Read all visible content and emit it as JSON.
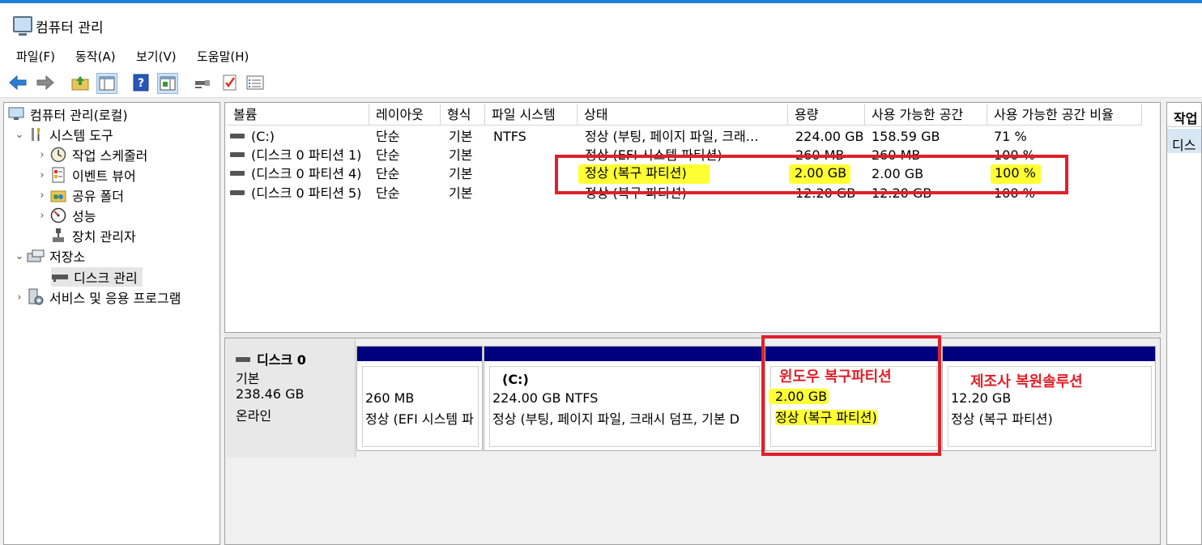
{
  "window": {
    "title": "컴퓨터 관리"
  },
  "menu": [
    "파일(F)",
    "동작(A)",
    "보기(V)",
    "도움말(H)"
  ],
  "toolbar_icons": [
    "back-arrow-icon",
    "forward-arrow-icon",
    "up-folder-icon",
    "show-hide-tree-icon",
    "help-icon",
    "action-pane-icon",
    "connect-icon",
    "check-icon",
    "properties-icon"
  ],
  "tree": {
    "root": "컴퓨터 관리(로컬)",
    "system_tools": "시스템 도구",
    "task_scheduler": "작업 스케줄러",
    "event_viewer": "이벤트 뷰어",
    "shared_folders": "공유 폴더",
    "performance": "성능",
    "device_manager": "장치 관리자",
    "storage": "저장소",
    "disk_management": "디스크 관리",
    "services": "서비스 및 응용 프로그램"
  },
  "columns": [
    "볼륨",
    "레이아웃",
    "형식",
    "파일 시스템",
    "상태",
    "용량",
    "사용 가능한 공간",
    "사용 가능한 공간 비율"
  ],
  "rows": [
    {
      "volume": "(C:)",
      "layout": "단순",
      "type": "기본",
      "fs": "NTFS",
      "status": "정상 (부팅, 페이지 파일, 크래…",
      "capacity": "224.00 GB",
      "free": "158.59 GB",
      "pct": "71 %"
    },
    {
      "volume": "(디스크 0 파티션 1)",
      "layout": "단순",
      "type": "기본",
      "fs": "",
      "status": "정상 (EFI 시스템 파티션)",
      "capacity": "260 MB",
      "free": "260 MB",
      "pct": "100 %"
    },
    {
      "volume": "(디스크 0 파티션 4)",
      "layout": "단순",
      "type": "기본",
      "fs": "",
      "status": "정상 (복구 파티션)",
      "capacity": "2.00 GB",
      "free": "2.00 GB",
      "pct": "100 %"
    },
    {
      "volume": "(디스크 0 파티션 5)",
      "layout": "단순",
      "type": "기본",
      "fs": "",
      "status": "정상 (복구 파티션)",
      "capacity": "12.20 GB",
      "free": "12.20 GB",
      "pct": "100 %"
    }
  ],
  "disk": {
    "name": "디스크 0",
    "kind": "기본",
    "size": "238.46 GB",
    "state": "온라인"
  },
  "partitions": [
    {
      "title": "",
      "size": "260 MB",
      "status": "정상 (EFI 시스템 파"
    },
    {
      "title": "(C:)",
      "size": "224.00 GB NTFS",
      "status": "정상 (부팅, 페이지 파일, 크래시 덤프, 기본 D"
    },
    {
      "title": "",
      "size": "2.00 GB",
      "status": "정상 (복구 파티션)"
    },
    {
      "title": "",
      "size": "12.20 GB",
      "status": "정상 (복구 파티션)"
    }
  ],
  "annotations": {
    "windows_recovery": "윈도우 복구파티션",
    "oem_recovery": "제조사 복원솔루션"
  },
  "actions": {
    "header": "작업",
    "item": "디스"
  },
  "colors": {
    "accent": "#1d82d6",
    "partition_bar": "#00007f",
    "highlight": "#ffff33",
    "annotation": "#e0202a"
  }
}
